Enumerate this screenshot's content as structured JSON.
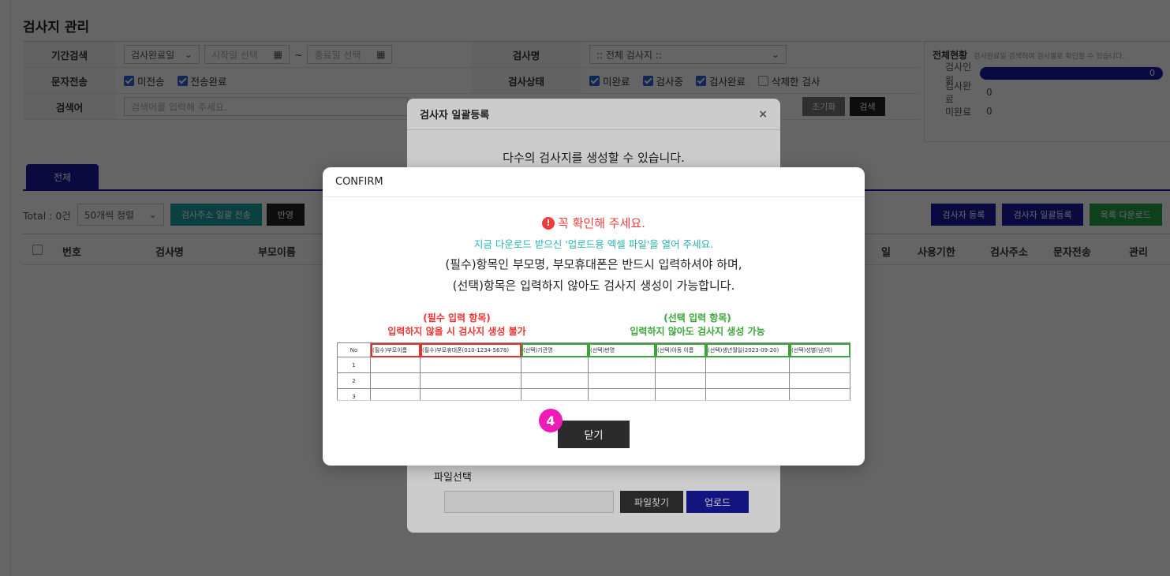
{
  "page": {
    "title": "검사지 관리"
  },
  "filter": {
    "period_label": "기간검색",
    "period_select": "검사완료일",
    "start_placeholder": "시작일 선택",
    "range_sep": "~",
    "end_placeholder": "종료일 선택",
    "name_label": "검사명",
    "name_select": ":: 전체 검사지 ::",
    "sms_label": "문자전송",
    "sms_options": [
      "미전송",
      "전송완료"
    ],
    "state_label": "검사상태",
    "state_options": [
      "미완료",
      "검사중",
      "검사완료",
      "삭제한 검사"
    ],
    "keyword_label": "검색어",
    "keyword_placeholder": "검색어를 입력해 주세요.",
    "reset_btn": "초기화",
    "search_btn": "검색"
  },
  "status": {
    "title": "전체현황",
    "note": "검사완료일 검색하여 검사별로 확인할 수 있습니다.",
    "rows": [
      {
        "label": "검사인원",
        "value": "0"
      },
      {
        "label": "검사완료",
        "value": "0"
      },
      {
        "label": "미완료",
        "value": "0"
      }
    ]
  },
  "tabs": {
    "all": "전체"
  },
  "toolbar": {
    "total": "Total : 0건",
    "sort": "50개씩 정렬",
    "send_btn": "검사주소 일괄 전송",
    "partial_btn": "반영",
    "register_btn": "검사자 등록",
    "bulk_btn": "검사자 일괄등록",
    "download_btn": "목록 다운로드"
  },
  "table": {
    "headers": [
      "번호",
      "검사명",
      "부모이름",
      "일",
      "사용기한",
      "검사주소",
      "문자전송",
      "관리"
    ]
  },
  "upload_modal": {
    "title": "검사자 일괄등록",
    "close": "×",
    "subtitle": "다수의 검사지를 생성할 수 있습니다.",
    "file_label": "파일선택",
    "find_btn": "파일찾기",
    "upload_btn": "업로드"
  },
  "confirm": {
    "title": "CONFIRM",
    "warn": "꼭 확인해 주세요.",
    "info": "지금 다운로드 받으신 '업로드용 엑셀 파일'을 열어 주세요.",
    "line1": "(필수)항목인 부모명, 부모휴대폰은 반드시 입력하셔야 하며,",
    "line2": "(선택)항목은 입력하지 않아도 검사지 생성이 가능합니다.",
    "required_title": "(필수 입력 항목)",
    "required_desc": "입력하지 않을 시 검사지 생성 불가",
    "optional_title": "(선택 입력 항목)",
    "optional_desc": "입력하지 않아도 검사지 생성 가능",
    "sheet_headers": [
      "No",
      "(필수)부모이름",
      "(필수)부모휴대폰(010-1234-5678)",
      "(선택)기관명",
      "(선택)반명",
      "(선택)아동 이름",
      "(선택)생년월일(2023-09-20)",
      "(선택)성별(남/여)"
    ],
    "sheet_rows": [
      "1",
      "2",
      "3"
    ],
    "step_badge": "4",
    "close_btn": "닫기"
  },
  "colors": {
    "navy": "#1a1aa0",
    "teal": "#1da2a2",
    "green": "#27a046",
    "magenta": "#ee1bb8",
    "warn_red": "#ee3b3b"
  }
}
